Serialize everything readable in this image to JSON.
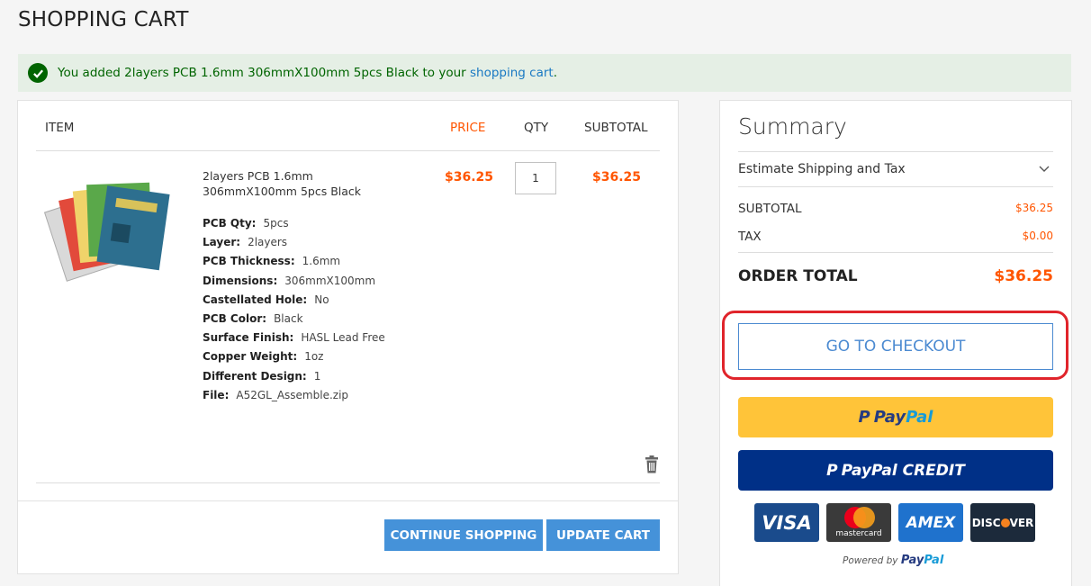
{
  "page": {
    "title": "SHOPPING CART"
  },
  "alert": {
    "prefix": "You added 2layers PCB 1.6mm 306mmX100mm 5pcs Black to your ",
    "link": "shopping cart",
    "suffix": "."
  },
  "cart": {
    "headers": {
      "item": "ITEM",
      "price": "PRICE",
      "qty": "QTY",
      "subtotal": "SUBTOTAL"
    },
    "item": {
      "name": "2layers PCB 1.6mm 306mmX100mm 5pcs Black",
      "price": "$36.25",
      "qty": "1",
      "subtotal": "$36.25",
      "options": [
        {
          "label": "PCB Qty:",
          "value": "5pcs"
        },
        {
          "label": "Layer:",
          "value": "2layers"
        },
        {
          "label": "PCB Thickness:",
          "value": "1.6mm"
        },
        {
          "label": "Dimensions:",
          "value": "306mmX100mm"
        },
        {
          "label": "Castellated Hole:",
          "value": "No"
        },
        {
          "label": "PCB Color:",
          "value": "Black"
        },
        {
          "label": "Surface Finish:",
          "value": "HASL Lead Free"
        },
        {
          "label": "Copper Weight:",
          "value": "1oz"
        },
        {
          "label": "Different Design:",
          "value": "1"
        },
        {
          "label": "File:",
          "value": "A52GL_Assemble.zip"
        }
      ]
    },
    "buttons": {
      "continue": "CONTINUE SHOPPING",
      "update": "UPDATE CART"
    }
  },
  "summary": {
    "title": "Summary",
    "estimate": "Estimate Shipping and Tax",
    "subtotal_label": "SUBTOTAL",
    "subtotal_value": "$36.25",
    "tax_label": "TAX",
    "tax_value": "$0.00",
    "order_total_label": "ORDER TOTAL",
    "order_total_value": "$36.25",
    "checkout": "GO TO CHECKOUT",
    "paypal": {
      "pay": "Pay",
      "pal": "Pal"
    },
    "paypal_credit": "PayPal CREDIT",
    "cards": {
      "visa": "VISA",
      "mastercard": "mastercard",
      "amex": "AMEX",
      "discover_a": "DISC",
      "discover_b": "VER"
    },
    "powered_by": "Powered by",
    "powered_brand_a": "Pay",
    "powered_brand_b": "Pal"
  },
  "colors": {
    "accent": "#ff5501",
    "link": "#1979c3",
    "button": "#4592d9",
    "highlight": "#e0242b"
  }
}
